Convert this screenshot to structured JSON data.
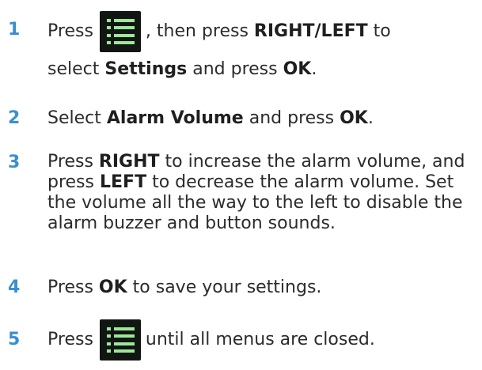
{
  "icons": {
    "menu": "menu-list-icon"
  },
  "colors": {
    "step_number": "#3a8fd0",
    "menu_icon_bg": "#121612",
    "menu_icon_lines": "#9be89b"
  },
  "steps": [
    {
      "number": "1",
      "press": "Press",
      "after_icon": ", then press",
      "key1": "RIGHT/LEFT",
      "to": "to",
      "select": "select",
      "item": "Settings",
      "and_press": "and press",
      "key2": "OK",
      "end": "."
    },
    {
      "number": "2",
      "select": "Select",
      "item": "Alarm Volume",
      "and_press": "and press",
      "key": "OK",
      "end": "."
    },
    {
      "number": "3",
      "press": "Press",
      "key1": "RIGHT",
      "mid1": "to increase the alarm volume, and press",
      "key2": "LEFT",
      "mid2": "to decrease the alarm volume. Set the volume all the way to the left to disable the alarm buzzer and button sounds."
    },
    {
      "number": "4",
      "press": "Press",
      "key": "OK",
      "rest": "to save your settings."
    },
    {
      "number": "5",
      "press": "Press",
      "rest": "until all menus are closed."
    }
  ]
}
